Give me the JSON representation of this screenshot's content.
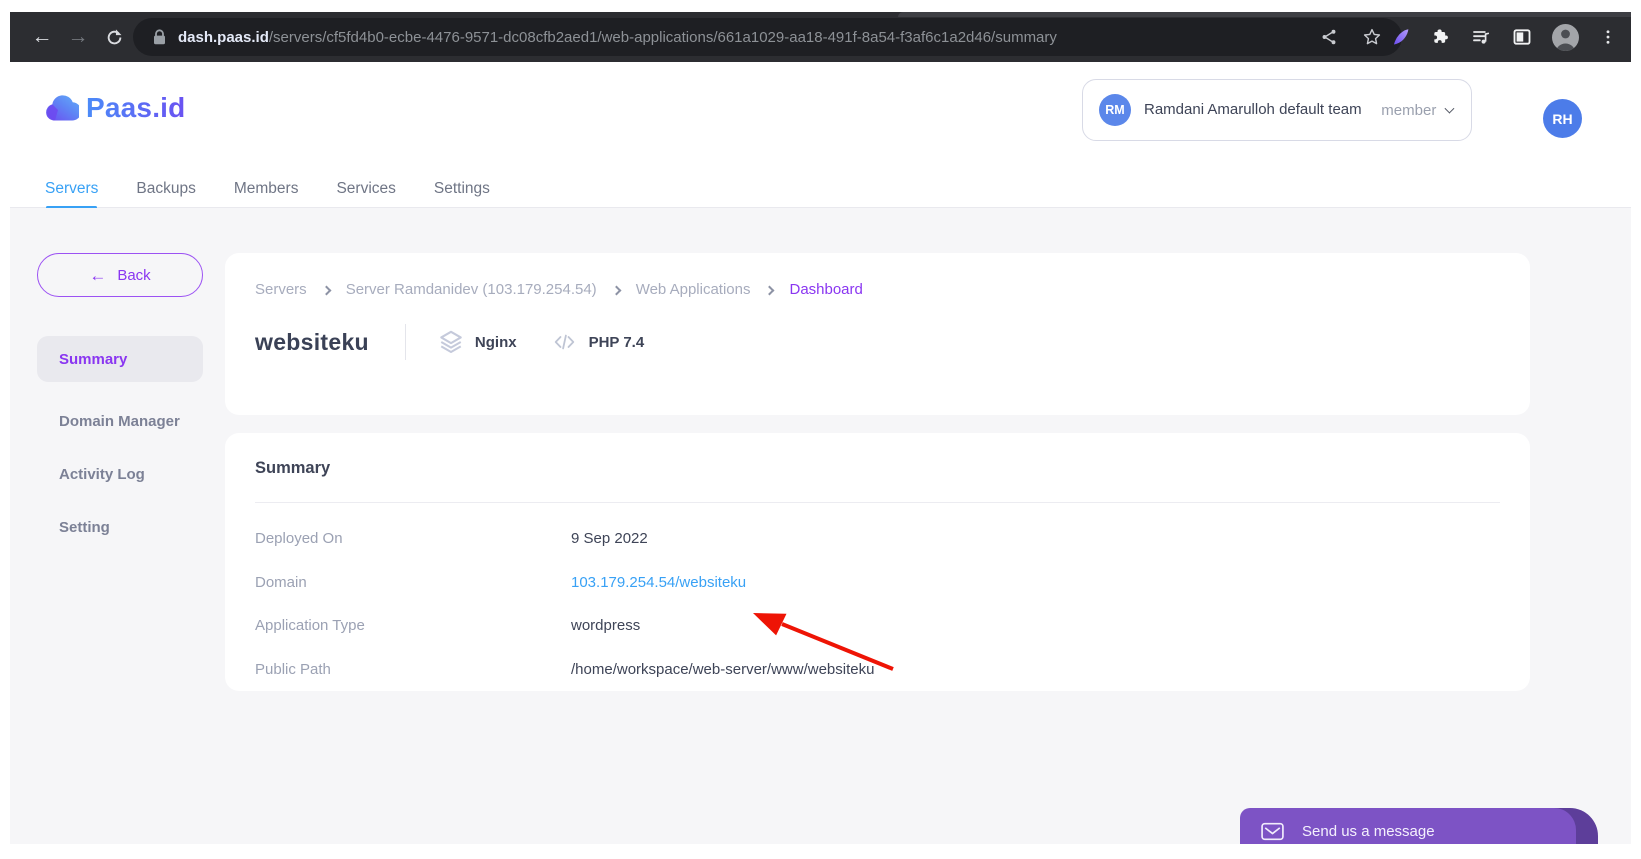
{
  "colors": {
    "accent_purple": "#8a36f1",
    "accent_blue": "#38a1f5",
    "arrow_red": "#ee1405",
    "chat_purple": "#7d53c5"
  },
  "browser": {
    "url": {
      "host": "dash.paas.id",
      "path": "/servers/cf5fd4b0-ecbe-4476-9571-dc08cfb2aed1/web-applications/661a1029-aa18-491f-8a54-f3af6c1a2d46/summary"
    }
  },
  "header": {
    "logo": "Paas.id",
    "team": {
      "initials": "RM",
      "name": "Ramdani Amarulloh default team",
      "role": "member"
    },
    "user": {
      "initials": "RH"
    }
  },
  "nav": {
    "tabs": [
      {
        "label": "Servers",
        "active": true
      },
      {
        "label": "Backups",
        "active": false
      },
      {
        "label": "Members",
        "active": false
      },
      {
        "label": "Services",
        "active": false
      },
      {
        "label": "Settings",
        "active": false
      }
    ]
  },
  "sidebar": {
    "back": "Back",
    "items": [
      {
        "label": "Summary",
        "active": true
      },
      {
        "label": "Domain Manager",
        "active": false
      },
      {
        "label": "Activity Log",
        "active": false
      },
      {
        "label": "Setting",
        "active": false
      }
    ]
  },
  "breadcrumb": {
    "items": [
      "Servers",
      "Server Ramdanidev (103.179.254.54)",
      "Web Applications",
      "Dashboard"
    ]
  },
  "app": {
    "title": "websiteku",
    "server": "Nginx",
    "runtime": "PHP 7.4"
  },
  "summary_card": {
    "heading": "Summary",
    "rows": [
      {
        "label": "Deployed On",
        "value": "9 Sep 2022"
      },
      {
        "label": "Domain",
        "value": "103.179.254.54/websiteku"
      },
      {
        "label": "Application Type",
        "value": "wordpress"
      },
      {
        "label": "Public Path",
        "value": "/home/workspace/web-server/www/websiteku"
      }
    ]
  },
  "chat": {
    "label": "Send us a message"
  }
}
